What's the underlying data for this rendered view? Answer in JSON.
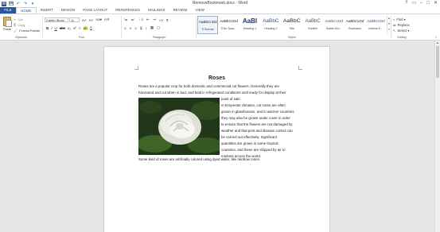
{
  "window": {
    "title": "RemoveBookmark.docx - Word",
    "controls": [
      "?",
      "▭",
      "–",
      "□",
      "✕"
    ]
  },
  "qat": [
    "W",
    "💾",
    "↶",
    "↷",
    "▾"
  ],
  "tabs": [
    "FILE",
    "HOME",
    "INSERT",
    "DESIGN",
    "PAGE LAYOUT",
    "REFERENCES",
    "MAILINGS",
    "REVIEW",
    "VIEW"
  ],
  "active_tab": "HOME",
  "ribbon": {
    "clipboard": {
      "paste_label": "Paste",
      "cut": "Cut",
      "copy": "Copy",
      "format_painter": "Format Painter",
      "group_label": "Clipboard"
    },
    "font": {
      "name": "Calibri (Body",
      "size": "11",
      "group_label": "Font",
      "row1": [
        "A˄",
        "A˅",
        "Aa▾",
        "A✕"
      ],
      "row2": [
        "B",
        "I",
        "U",
        "abc",
        "x₂",
        "x²",
        "A",
        "ab",
        "A"
      ]
    },
    "paragraph": {
      "group_label": "Paragraph",
      "row1": [
        "≔",
        "≕",
        "⋮≡",
        "⇤",
        "⇥",
        "↕A",
        "¶"
      ],
      "row2": [
        "≡",
        "≡",
        "≡",
        "≡",
        "↕",
        "▦",
        "▢"
      ]
    },
    "styles": {
      "group_label": "Styles",
      "items": [
        {
          "preview": "AaBbCcDd",
          "name": "¶ Normal"
        },
        {
          "preview": "AaBbCcDd",
          "name": "¶ No Spac..."
        },
        {
          "preview": "AaBI",
          "name": "Heading 1"
        },
        {
          "preview": "AaBbC",
          "name": "Heading 2"
        },
        {
          "preview": "AaBbC",
          "name": "Title"
        },
        {
          "preview": "AaBbC",
          "name": "Subtitle"
        },
        {
          "preview": "AaBbCcDd",
          "name": "Subtle Em..."
        },
        {
          "preview": "AaBbCcDd",
          "name": "Emphasis"
        },
        {
          "preview": "AaBbCcDd",
          "name": "Intense E..."
        }
      ]
    },
    "editing": {
      "find": "Find ▾",
      "replace": "Replace",
      "select": "Select ▾",
      "group_label": "Editing"
    }
  },
  "document": {
    "title": "Roses",
    "para1_line1": "Roses are a popular crop for both domestic and commercial cut flowers. Generally they are",
    "para1_line2": "harvested and cut when in bud, and held in refrigerated conditions until ready for display at their",
    "para1_line3": "point of sale.",
    "para2": [
      "In temperate climates, cut roses are often",
      "grown in glasshouses, and in warmer countries",
      "they may also be grown under cover in order",
      "to ensure that the flowers are not damaged by",
      "weather and that pest and disease control can",
      "be carried out effectively. Significant",
      "quantities are grown in some tropical",
      "countries, and these are shipped by air to",
      "markets across the world."
    ],
    "para3": "Some kind of roses are artificially colored using dyed water, like rainbow roses."
  },
  "colors": {
    "accent": "#2b579a",
    "page": "#ffffff",
    "workspace": "#e6e6e6"
  }
}
